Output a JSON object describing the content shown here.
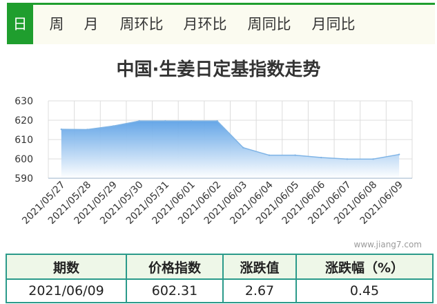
{
  "tabs": [
    {
      "label": "日",
      "active": true
    },
    {
      "label": "周",
      "active": false
    },
    {
      "label": "月",
      "active": false
    },
    {
      "label": "周环比",
      "active": false
    },
    {
      "label": "月环比",
      "active": false
    },
    {
      "label": "周同比",
      "active": false
    },
    {
      "label": "月同比",
      "active": false
    }
  ],
  "watermark": "www.jiang7.com",
  "chart_data": {
    "type": "area",
    "title": "中国·生姜日定基指数走势",
    "xlabel": "",
    "ylabel": "",
    "ylim": [
      590,
      630
    ],
    "yticks": [
      590,
      600,
      610,
      620,
      630
    ],
    "categories": [
      "2021/05/27",
      "2021/05/28",
      "2021/05/29",
      "2021/05/30",
      "2021/05/31",
      "2021/06/01",
      "2021/06/02",
      "2021/06/03",
      "2021/06/04",
      "2021/06/05",
      "2021/06/06",
      "2021/06/07",
      "2021/06/08",
      "2021/06/09"
    ],
    "values": [
      615.3,
      615.2,
      617.0,
      619.6,
      619.6,
      619.6,
      619.6,
      605.8,
      601.9,
      601.9,
      600.7,
      599.9,
      599.9,
      602.3
    ],
    "grid": true,
    "colors": {
      "line": "#7fb4e6",
      "fill_top": "#5ea2e6",
      "fill_bottom": "#ffffff",
      "grid": "#dcdcdc"
    }
  },
  "stats": {
    "headers": [
      "期数",
      "价格指数",
      "涨跌值",
      "涨跌幅（%）"
    ],
    "row": [
      "2021/06/09",
      "602.31",
      "2.67",
      "0.45"
    ]
  }
}
